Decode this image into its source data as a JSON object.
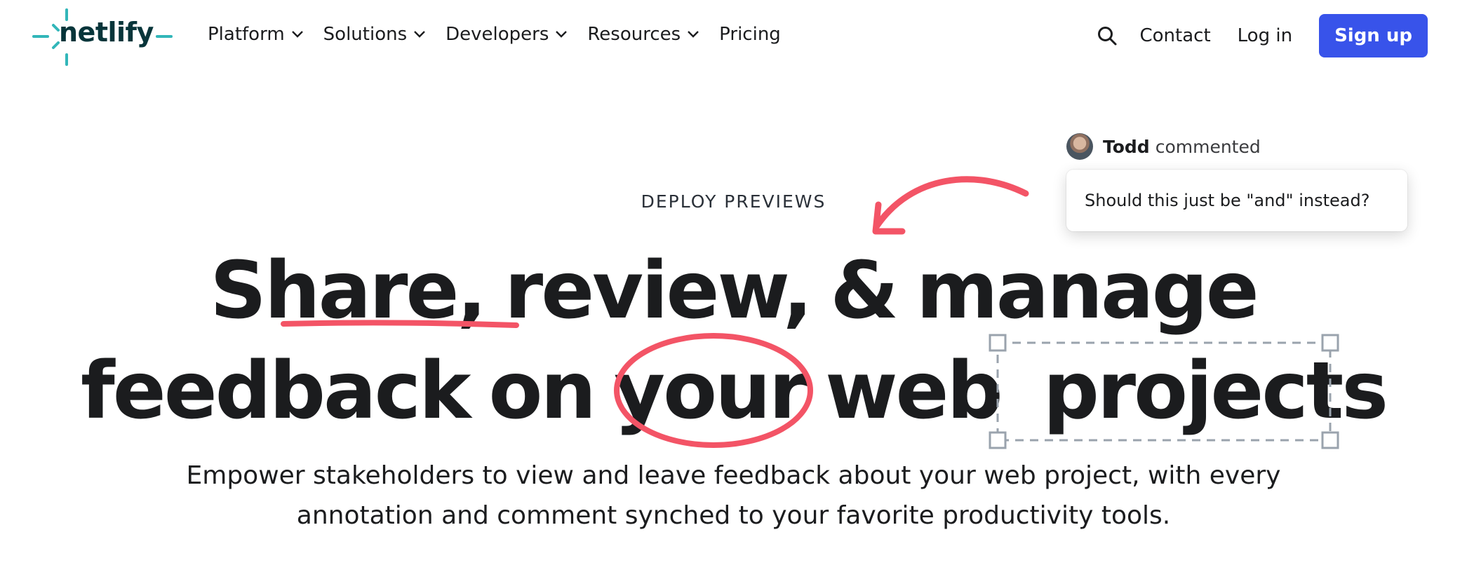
{
  "logo": {
    "text": "netlify"
  },
  "nav": {
    "items": [
      {
        "label": "Platform",
        "has_dropdown": true
      },
      {
        "label": "Solutions",
        "has_dropdown": true
      },
      {
        "label": "Developers",
        "has_dropdown": true
      },
      {
        "label": "Resources",
        "has_dropdown": true
      },
      {
        "label": "Pricing",
        "has_dropdown": false
      }
    ],
    "search_icon": "search-icon",
    "contact_label": "Contact",
    "login_label": "Log in",
    "signup_label": "Sign up"
  },
  "comment": {
    "author": "Todd",
    "verb": "commented",
    "text": "Should this just be \"and\" instead?"
  },
  "hero": {
    "eyebrow": "DEPLOY PREVIEWS",
    "headline_line1": [
      "Share,",
      "review,",
      "&",
      "manage"
    ],
    "headline_line2": [
      "feedback",
      "on",
      "your",
      "web",
      "projects"
    ],
    "subtitle_line1": "Empower stakeholders to view and leave feedback about your web project, with every",
    "subtitle_line2": "annotation and comment synched to your favorite productivity tools."
  },
  "colors": {
    "brand_dark": "#07353a",
    "brand_teal": "#32b6b9",
    "signup_blue": "#3853ea",
    "annotation_red": "#f35466",
    "selection_gray": "#9aa3ad",
    "text": "#1b1c1e"
  }
}
